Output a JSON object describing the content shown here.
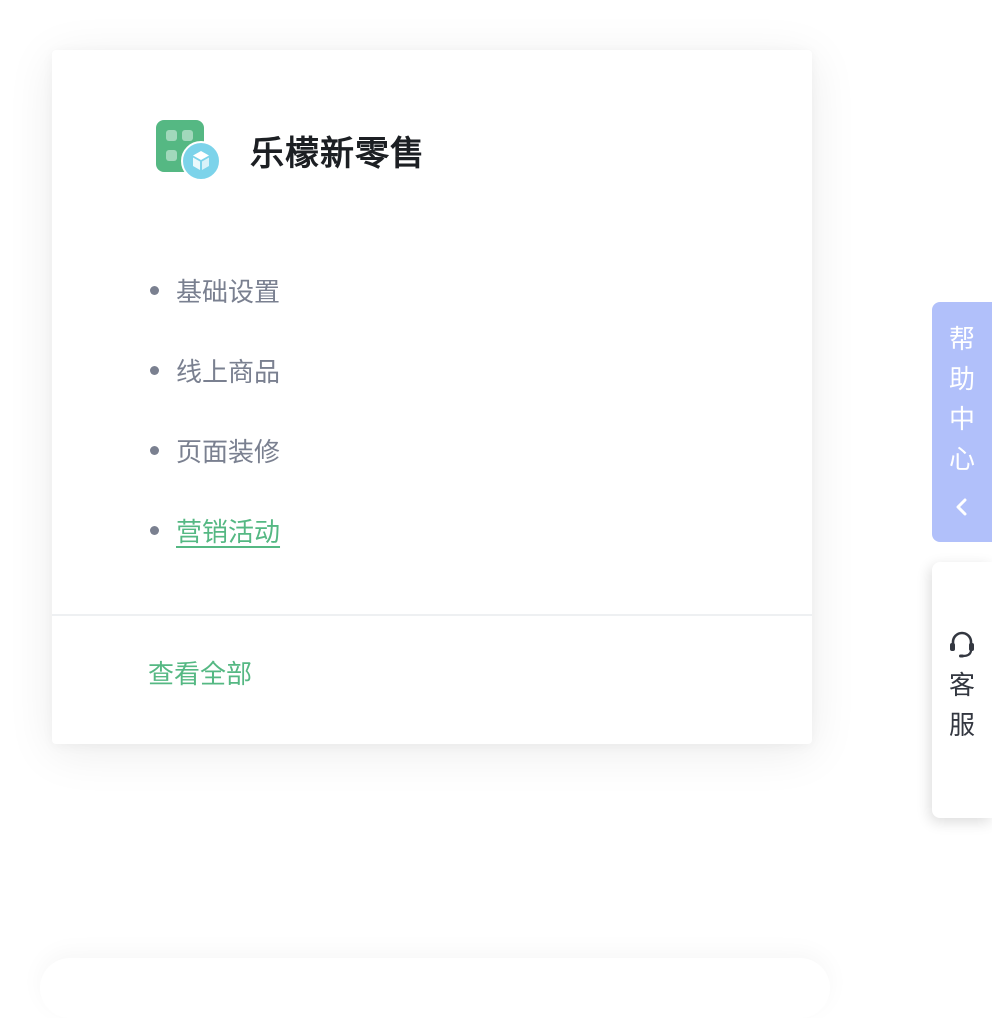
{
  "app": {
    "name": "乐檬新零售",
    "logo_icon": "app-grid-cube-icon",
    "colors": {
      "tile": "#55b883",
      "badge": "#7cd3ea"
    }
  },
  "menu": {
    "items": [
      {
        "label": "基础设置",
        "active": false
      },
      {
        "label": "线上商品",
        "active": false
      },
      {
        "label": "页面装修",
        "active": false
      },
      {
        "label": "营销活动",
        "active": true
      }
    ]
  },
  "footer": {
    "view_all_label": "查看全部"
  },
  "help_center": {
    "chars": [
      "帮",
      "助",
      "中",
      "心"
    ],
    "icon": "chevron-left-icon"
  },
  "customer_service": {
    "chars": [
      "客",
      "服"
    ],
    "icon": "headset-icon"
  },
  "theme": {
    "accent": "#55b883",
    "muted_text": "#7a8090",
    "help_tab_bg": "#b1c0fa"
  }
}
